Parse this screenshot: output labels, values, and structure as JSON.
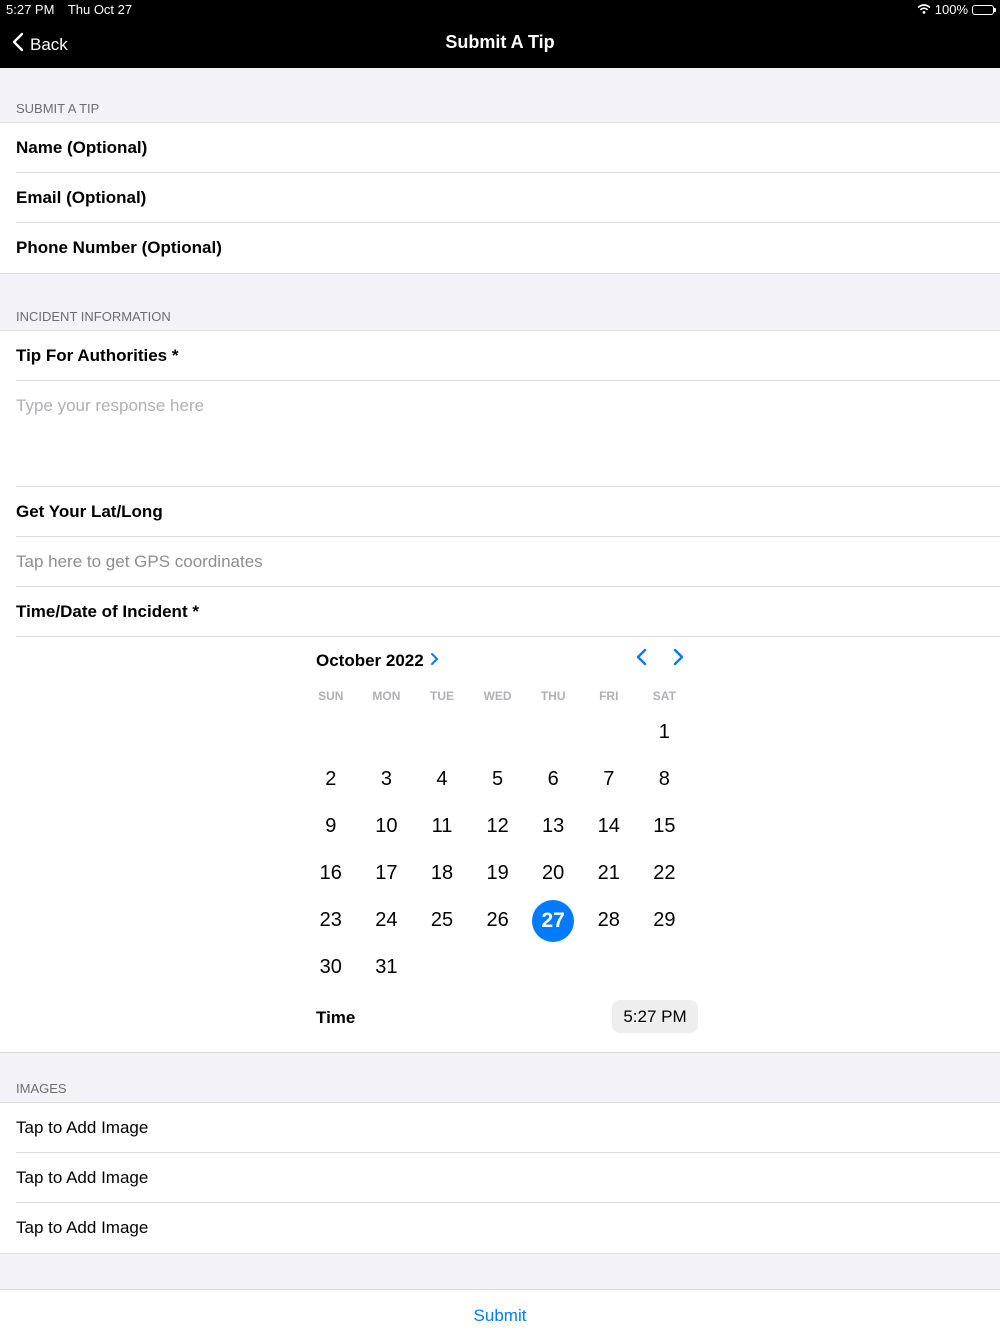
{
  "status_bar": {
    "time": "5:27 PM",
    "date": "Thu Oct 27",
    "battery": "100%"
  },
  "nav": {
    "back_label": "Back",
    "title": "Submit A Tip"
  },
  "sections": {
    "submit": {
      "header": "SUBMIT A TIP",
      "name": "Name (Optional)",
      "email": "Email (Optional)",
      "phone": "Phone Number (Optional)"
    },
    "incident": {
      "header": "INCIDENT INFORMATION",
      "tip_label": "Tip For Authorities *",
      "tip_placeholder": "Type your response here",
      "latlong_label": "Get Your Lat/Long",
      "gps_prompt": "Tap here to get GPS coordinates",
      "datetime_label": "Time/Date of Incident *"
    },
    "images": {
      "header": "IMAGES",
      "items": [
        "Tap to Add Image",
        "Tap to Add Image",
        "Tap to Add Image"
      ]
    }
  },
  "calendar": {
    "month_label": "October 2022",
    "weekdays": [
      "SUN",
      "MON",
      "TUE",
      "WED",
      "THU",
      "FRI",
      "SAT"
    ],
    "days": [
      "",
      "",
      "",
      "",
      "",
      "",
      "1",
      "2",
      "3",
      "4",
      "5",
      "6",
      "7",
      "8",
      "9",
      "10",
      "11",
      "12",
      "13",
      "14",
      "15",
      "16",
      "17",
      "18",
      "19",
      "20",
      "21",
      "22",
      "23",
      "24",
      "25",
      "26",
      "27",
      "28",
      "29",
      "30",
      "31"
    ],
    "selected_day": "27",
    "time_label": "Time",
    "time_value": "5:27 PM"
  },
  "footer": {
    "submit_label": "Submit"
  },
  "colors": {
    "accent": "#007aff",
    "nav_bg": "#000000",
    "grouped_bg": "#f2f2f7"
  }
}
